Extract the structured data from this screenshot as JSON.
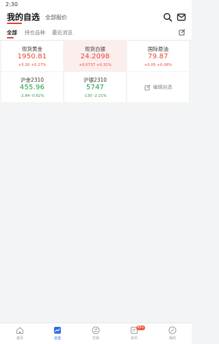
{
  "status_bar": {
    "time": "2:30"
  },
  "header": {
    "title": "我的自选",
    "subtitle": "全部报价"
  },
  "tabs": [
    {
      "label": "全部",
      "active": true
    },
    {
      "label": "持仓品种",
      "active": false
    },
    {
      "label": "最近浏览",
      "active": false
    }
  ],
  "quotes": [
    {
      "name": "现货黄金",
      "price": "1950.81",
      "change": "+5.26 +0.27%",
      "direction": "up",
      "highlighted": false
    },
    {
      "name": "现货白银",
      "price": "24.2098",
      "change": "+0.0737 +0.31%",
      "direction": "up",
      "highlighted": true
    },
    {
      "name": "国际原油",
      "price": "79.87",
      "change": "+0.05 +0.06%",
      "direction": "up",
      "highlighted": false
    },
    {
      "name": "沪金2310",
      "price": "455.96",
      "change": "-2.84 -0.62%",
      "direction": "down",
      "highlighted": false
    },
    {
      "name": "沪银2310",
      "price": "5747",
      "change": "-130 -2.21%",
      "direction": "down",
      "highlighted": false
    }
  ],
  "edit_watchlist": {
    "label": "编辑自选"
  },
  "bottom_nav": [
    {
      "label": "首页",
      "icon": "home-icon",
      "active": false
    },
    {
      "label": "自选",
      "icon": "watchlist-icon",
      "active": true
    },
    {
      "label": "交易",
      "icon": "trade-icon",
      "active": false
    },
    {
      "label": "资讯",
      "icon": "news-icon",
      "active": false,
      "badge": "99+"
    },
    {
      "label": "我的",
      "icon": "profile-icon",
      "active": false
    }
  ],
  "colors": {
    "up": "#e8432f",
    "down": "#1f9c40",
    "accent": "#e03b3b",
    "nav_active": "#2f6fe8"
  }
}
